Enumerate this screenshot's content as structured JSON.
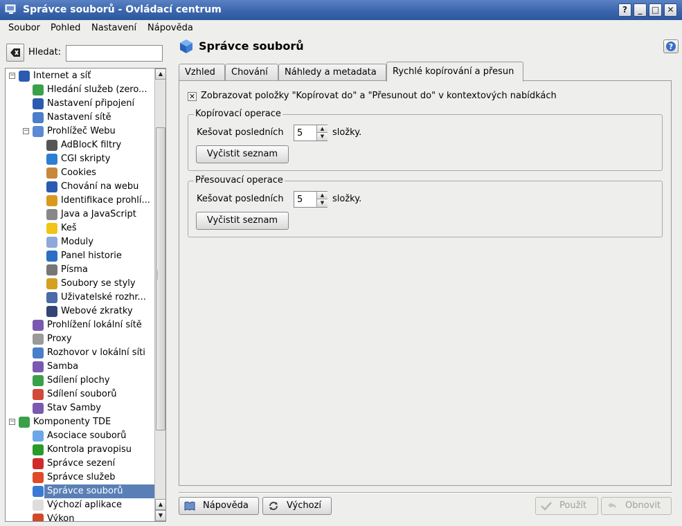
{
  "window": {
    "title": "Správce souborů - Ovládací centrum",
    "buttons": [
      "?",
      "_",
      "□",
      "✕"
    ]
  },
  "menubar": {
    "items": [
      "Soubor",
      "Pohled",
      "Nastavení",
      "Nápověda"
    ]
  },
  "search": {
    "label": "Hledat:",
    "value": ""
  },
  "tree": {
    "items": [
      {
        "label": "Internet a síť",
        "level": 0,
        "icon": "globe-icon",
        "color": "#2a5bb0",
        "expander": "⊖"
      },
      {
        "label": "Hledání služeb (zero...",
        "level": 1,
        "icon": "zeroconf-icon",
        "color": "#3aa04a"
      },
      {
        "label": "Nastavení připojení",
        "level": 1,
        "icon": "globe-icon",
        "color": "#2a5bb0"
      },
      {
        "label": "Nastavení sítě",
        "level": 1,
        "icon": "network-icon",
        "color": "#4a7ec8"
      },
      {
        "label": "Prohlížeč Webu",
        "level": 1,
        "icon": "web-browser-icon",
        "color": "#5b8ad6",
        "expander": "⊖"
      },
      {
        "label": "AdBlocK filtry",
        "level": 2,
        "icon": "filter-icon",
        "color": "#555555"
      },
      {
        "label": "CGI skripty",
        "level": 2,
        "icon": "gear-icon",
        "color": "#2c7fd4"
      },
      {
        "label": "Cookies",
        "level": 2,
        "icon": "cookie-icon",
        "color": "#c9873a"
      },
      {
        "label": "Chování na webu",
        "level": 2,
        "icon": "globe-icon",
        "color": "#2a5bb0"
      },
      {
        "label": "Identifikace prohlí...",
        "level": 2,
        "icon": "warning-icon",
        "color": "#d89a1e"
      },
      {
        "label": "Java a JavaScript",
        "level": 2,
        "icon": "java-icon",
        "color": "#888888"
      },
      {
        "label": "Keš",
        "level": 2,
        "icon": "cache-icon",
        "color": "#f2c418"
      },
      {
        "label": "Moduly",
        "level": 2,
        "icon": "plugin-icon",
        "color": "#8fa8d8"
      },
      {
        "label": "Panel historie",
        "level": 2,
        "icon": "clock-icon",
        "color": "#2a6fc4"
      },
      {
        "label": "Písma",
        "level": 2,
        "icon": "font-icon",
        "color": "#777777"
      },
      {
        "label": "Soubory se styly",
        "level": 2,
        "icon": "css-icon",
        "color": "#d4a020"
      },
      {
        "label": "Uživatelské rozhr...",
        "level": 2,
        "icon": "list-icon",
        "color": "#4a6aa8"
      },
      {
        "label": "Webové zkratky",
        "level": 2,
        "icon": "shortcut-icon",
        "color": "#334477"
      },
      {
        "label": "Prohlížení lokální sítě",
        "level": 1,
        "icon": "monitor-icon",
        "color": "#7a5ab0"
      },
      {
        "label": "Proxy",
        "level": 1,
        "icon": "proxy-icon",
        "color": "#9a9a9a"
      },
      {
        "label": "Rozhovor v lokální síti",
        "level": 1,
        "icon": "chat-icon",
        "color": "#4a7ec8"
      },
      {
        "label": "Samba",
        "level": 1,
        "icon": "samba-icon",
        "color": "#7a5ab0"
      },
      {
        "label": "Sdílení plochy",
        "level": 1,
        "icon": "desktop-share-icon",
        "color": "#3aa04a"
      },
      {
        "label": "Sdílení souborů",
        "level": 1,
        "icon": "file-share-icon",
        "color": "#d04a3a"
      },
      {
        "label": "Stav Samby",
        "level": 1,
        "icon": "samba-status-icon",
        "color": "#7a5ab0"
      },
      {
        "label": "Komponenty TDE",
        "level": 0,
        "icon": "components-icon",
        "color": "#3aa04a",
        "expander": "⊖"
      },
      {
        "label": "Asociace souborů",
        "level": 1,
        "icon": "bubble-icon",
        "color": "#6aa8e8"
      },
      {
        "label": "Kontrola pravopisu",
        "level": 1,
        "icon": "spellcheck-icon",
        "color": "#2a9a2a"
      },
      {
        "label": "Správce sezení",
        "level": 1,
        "icon": "power-icon",
        "color": "#d02a2a"
      },
      {
        "label": "Správce služeb",
        "level": 1,
        "icon": "services-icon",
        "color": "#e04a2a"
      },
      {
        "label": "Správce souborů",
        "level": 1,
        "icon": "cube-icon",
        "color": "#3a7ad4",
        "selected": true
      },
      {
        "label": "Výchozí aplikace",
        "level": 1,
        "icon": "document-icon",
        "color": "#dddddd"
      },
      {
        "label": "Výkon",
        "level": 1,
        "icon": "performance-icon",
        "color": "#d04a2a"
      }
    ]
  },
  "module": {
    "title": "Správce souborů"
  },
  "tabs": [
    {
      "label": "Vzhled"
    },
    {
      "label": "Chování"
    },
    {
      "label": "Náhledy a metadata"
    },
    {
      "label": "Rychlé kopírování a přesun",
      "active": true
    }
  ],
  "content": {
    "checkbox_label": "Zobrazovat položky \"Kopírovat do\" a \"Přesunout do\" v kontextových nabídkách",
    "checkbox_checked": "✕",
    "copy_group": {
      "title": "Kopírovací operace",
      "label": "Kešovat posledních",
      "value": "5",
      "suffix": "složky.",
      "button": "Vyčistit seznam"
    },
    "move_group": {
      "title": "Přesouvací operace",
      "label": "Kešovat posledních",
      "value": "5",
      "suffix": "složky.",
      "button": "Vyčistit seznam"
    }
  },
  "buttons": {
    "help": "Nápověda",
    "defaults": "Výchozí",
    "apply": "Použít",
    "reset": "Obnovit"
  }
}
